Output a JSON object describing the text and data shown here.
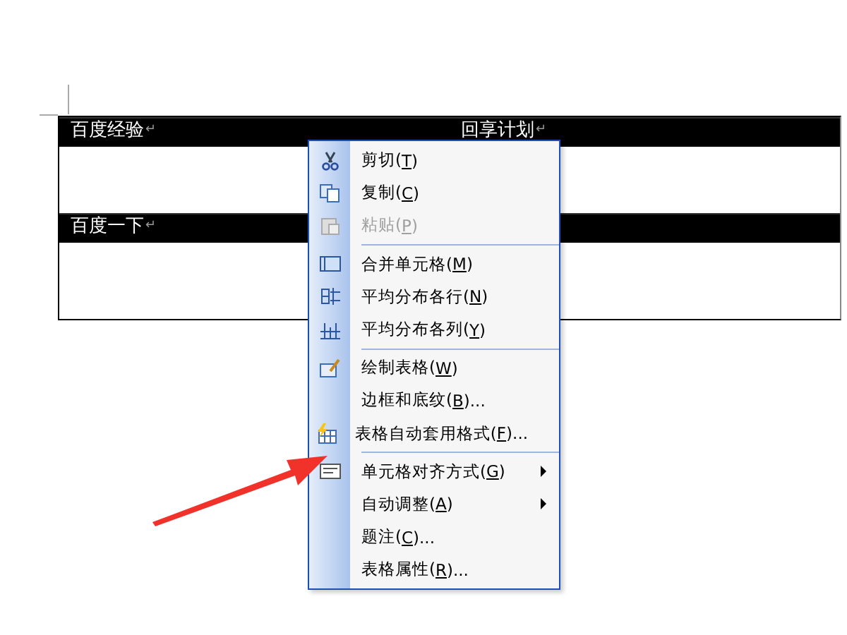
{
  "table": {
    "rows": [
      {
        "kind": "header",
        "cells": [
          {
            "text": "百度经验",
            "end_mark": "↵"
          },
          {
            "text": "回享计划",
            "end_mark": "↵"
          }
        ]
      },
      {
        "kind": "blank"
      },
      {
        "kind": "header",
        "cells": [
          {
            "text": "百度一下",
            "end_mark": "↵"
          }
        ]
      },
      {
        "kind": "blank"
      }
    ]
  },
  "context_menu": {
    "items": [
      {
        "kind": "command",
        "prefix": "剪切(",
        "key": "T",
        "suffix": ")",
        "disabled": false,
        "submenu": false
      },
      {
        "kind": "command",
        "prefix": "复制(",
        "key": "C",
        "suffix": ")",
        "disabled": false,
        "submenu": false
      },
      {
        "kind": "command",
        "prefix": "粘贴(",
        "key": "P",
        "suffix": ")",
        "disabled": true,
        "submenu": false
      },
      {
        "kind": "separator"
      },
      {
        "kind": "command",
        "prefix": "合并单元格(",
        "key": "M",
        "suffix": ")",
        "disabled": false,
        "submenu": false
      },
      {
        "kind": "command",
        "prefix": "平均分布各行(",
        "key": "N",
        "suffix": ")",
        "disabled": false,
        "submenu": false
      },
      {
        "kind": "command",
        "prefix": "平均分布各列(",
        "key": "Y",
        "suffix": ")",
        "disabled": false,
        "submenu": false
      },
      {
        "kind": "separator"
      },
      {
        "kind": "command",
        "prefix": "绘制表格(",
        "key": "W",
        "suffix": ")",
        "disabled": false,
        "submenu": false
      },
      {
        "kind": "command",
        "prefix": "边框和底纹(",
        "key": "B",
        "suffix": ")...",
        "disabled": false,
        "submenu": false
      },
      {
        "kind": "command",
        "prefix": "表格自动套用格式(",
        "key": "F",
        "suffix": ")...",
        "disabled": false,
        "submenu": false
      },
      {
        "kind": "separator"
      },
      {
        "kind": "command",
        "prefix": "单元格对齐方式(",
        "key": "G",
        "suffix": ")",
        "disabled": false,
        "submenu": true
      },
      {
        "kind": "command",
        "prefix": "自动调整(",
        "key": "A",
        "suffix": ")",
        "disabled": false,
        "submenu": true
      },
      {
        "kind": "command",
        "prefix": "题注(",
        "key": "C",
        "suffix": ")...",
        "disabled": false,
        "submenu": false
      },
      {
        "kind": "command",
        "prefix": "表格属性(",
        "key": "R",
        "suffix": ")...",
        "disabled": false,
        "submenu": false
      }
    ]
  }
}
